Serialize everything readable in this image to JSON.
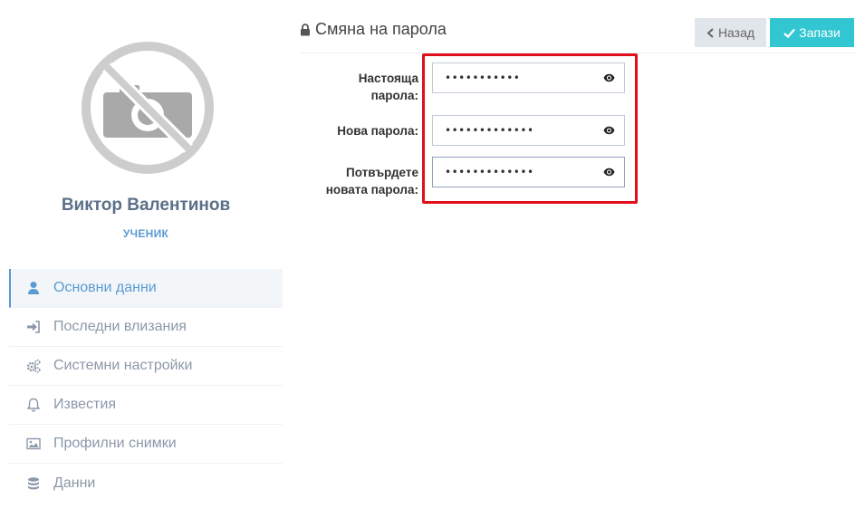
{
  "profile": {
    "name": "Виктор Валентинов",
    "role": "УЧЕНИК",
    "avatar_icon": "no-photo-icon"
  },
  "sidebar": {
    "items": [
      {
        "label": "Основни данни",
        "icon": "user-icon",
        "active": true
      },
      {
        "label": "Последни влизания",
        "icon": "sign-in-icon",
        "active": false
      },
      {
        "label": "Системни настройки",
        "icon": "gears-icon",
        "active": false
      },
      {
        "label": "Известия",
        "icon": "bell-icon",
        "active": false
      },
      {
        "label": "Профилни снимки",
        "icon": "image-icon",
        "active": false
      },
      {
        "label": "Данни",
        "icon": "database-icon",
        "active": false
      }
    ]
  },
  "header": {
    "title": "Смяна на парола",
    "title_icon": "lock-icon",
    "back_label": "Назад",
    "save_label": "Запази"
  },
  "form": {
    "current_password": {
      "label_line1": "Настояща",
      "label_line2": "парола:",
      "value": "•••••••••••"
    },
    "new_password": {
      "label": "Нова парола:",
      "value": "•••••••••••••"
    },
    "confirm_password": {
      "label_line1": "Потвърдете",
      "label_line2": "новата парола:",
      "value": "•••••••••••••"
    }
  },
  "colors": {
    "accent": "#5b9bd1",
    "save_button": "#32c5d2",
    "back_button": "#e1e5ec",
    "highlight": "#e0101a"
  }
}
